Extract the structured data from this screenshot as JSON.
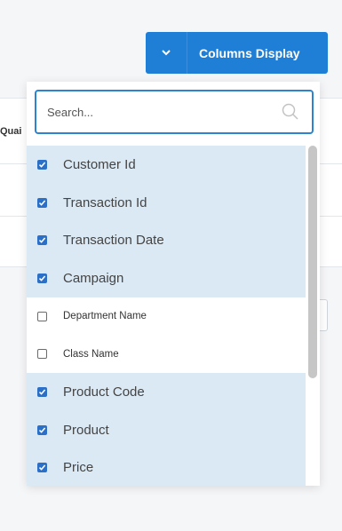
{
  "button": {
    "label": "Columns Display",
    "caret_icon": "chevron-down-icon"
  },
  "background": {
    "column_fragment": "Quai"
  },
  "search": {
    "placeholder": "Search...",
    "icon": "search-icon"
  },
  "columns": [
    {
      "label": "Customer Id",
      "checked": true
    },
    {
      "label": "Transaction Id",
      "checked": true
    },
    {
      "label": "Transaction Date",
      "checked": true
    },
    {
      "label": "Campaign",
      "checked": true
    },
    {
      "label": "Department Name",
      "checked": false
    },
    {
      "label": "Class Name",
      "checked": false
    },
    {
      "label": "Product Code",
      "checked": true
    },
    {
      "label": "Product",
      "checked": true
    },
    {
      "label": "Price",
      "checked": true
    }
  ],
  "colors": {
    "accent": "#1f7ed6",
    "selected_row": "#dbe9f5",
    "checkbox": "#2c6fc6"
  }
}
